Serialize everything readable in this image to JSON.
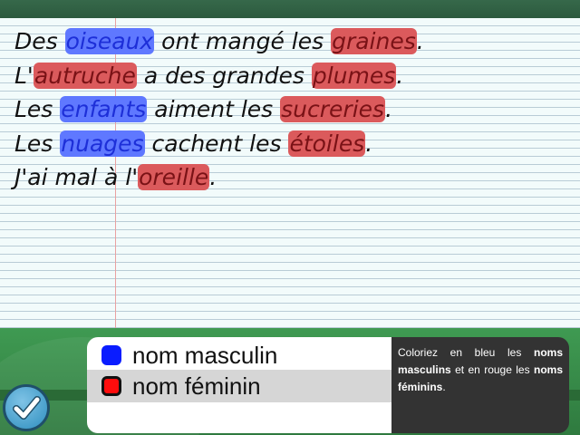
{
  "sentences": [
    [
      {
        "text": "Des ",
        "type": "plain"
      },
      {
        "text": "oiseaux",
        "type": "masc"
      },
      {
        "text": " ont mangé les ",
        "type": "plain"
      },
      {
        "text": "graines",
        "type": "fem"
      },
      {
        "text": ".",
        "type": "plain"
      }
    ],
    [
      {
        "text": "L'",
        "type": "plain"
      },
      {
        "text": "autruche",
        "type": "fem"
      },
      {
        "text": " a des grandes ",
        "type": "plain"
      },
      {
        "text": "plumes",
        "type": "fem"
      },
      {
        "text": ".",
        "type": "plain"
      }
    ],
    [
      {
        "text": "Les ",
        "type": "plain"
      },
      {
        "text": "enfants",
        "type": "masc"
      },
      {
        "text": " aiment les ",
        "type": "plain"
      },
      {
        "text": "sucreries",
        "type": "fem"
      },
      {
        "text": ".",
        "type": "plain"
      }
    ],
    [
      {
        "text": "Les ",
        "type": "plain"
      },
      {
        "text": "nuages",
        "type": "masc"
      },
      {
        "text": " cachent les ",
        "type": "plain"
      },
      {
        "text": "étoiles",
        "type": "fem"
      },
      {
        "text": ".",
        "type": "plain"
      }
    ],
    [
      {
        "text": "J'ai mal à l'",
        "type": "plain"
      },
      {
        "text": "oreille",
        "type": "fem"
      },
      {
        "text": ".",
        "type": "plain"
      }
    ]
  ],
  "legend": {
    "masculine_label": "nom masculin",
    "feminine_label": "nom féminin",
    "selected": "feminine",
    "colors": {
      "masculine": "#0a1cff",
      "feminine": "#ff0d0d"
    }
  },
  "instructions": {
    "part1": "Coloriez en bleu les ",
    "bold1": "noms masculins",
    "part2": " et en rouge les ",
    "bold2": "noms féminins",
    "part3": "."
  },
  "check_button": {
    "icon": "checkmark-icon"
  }
}
